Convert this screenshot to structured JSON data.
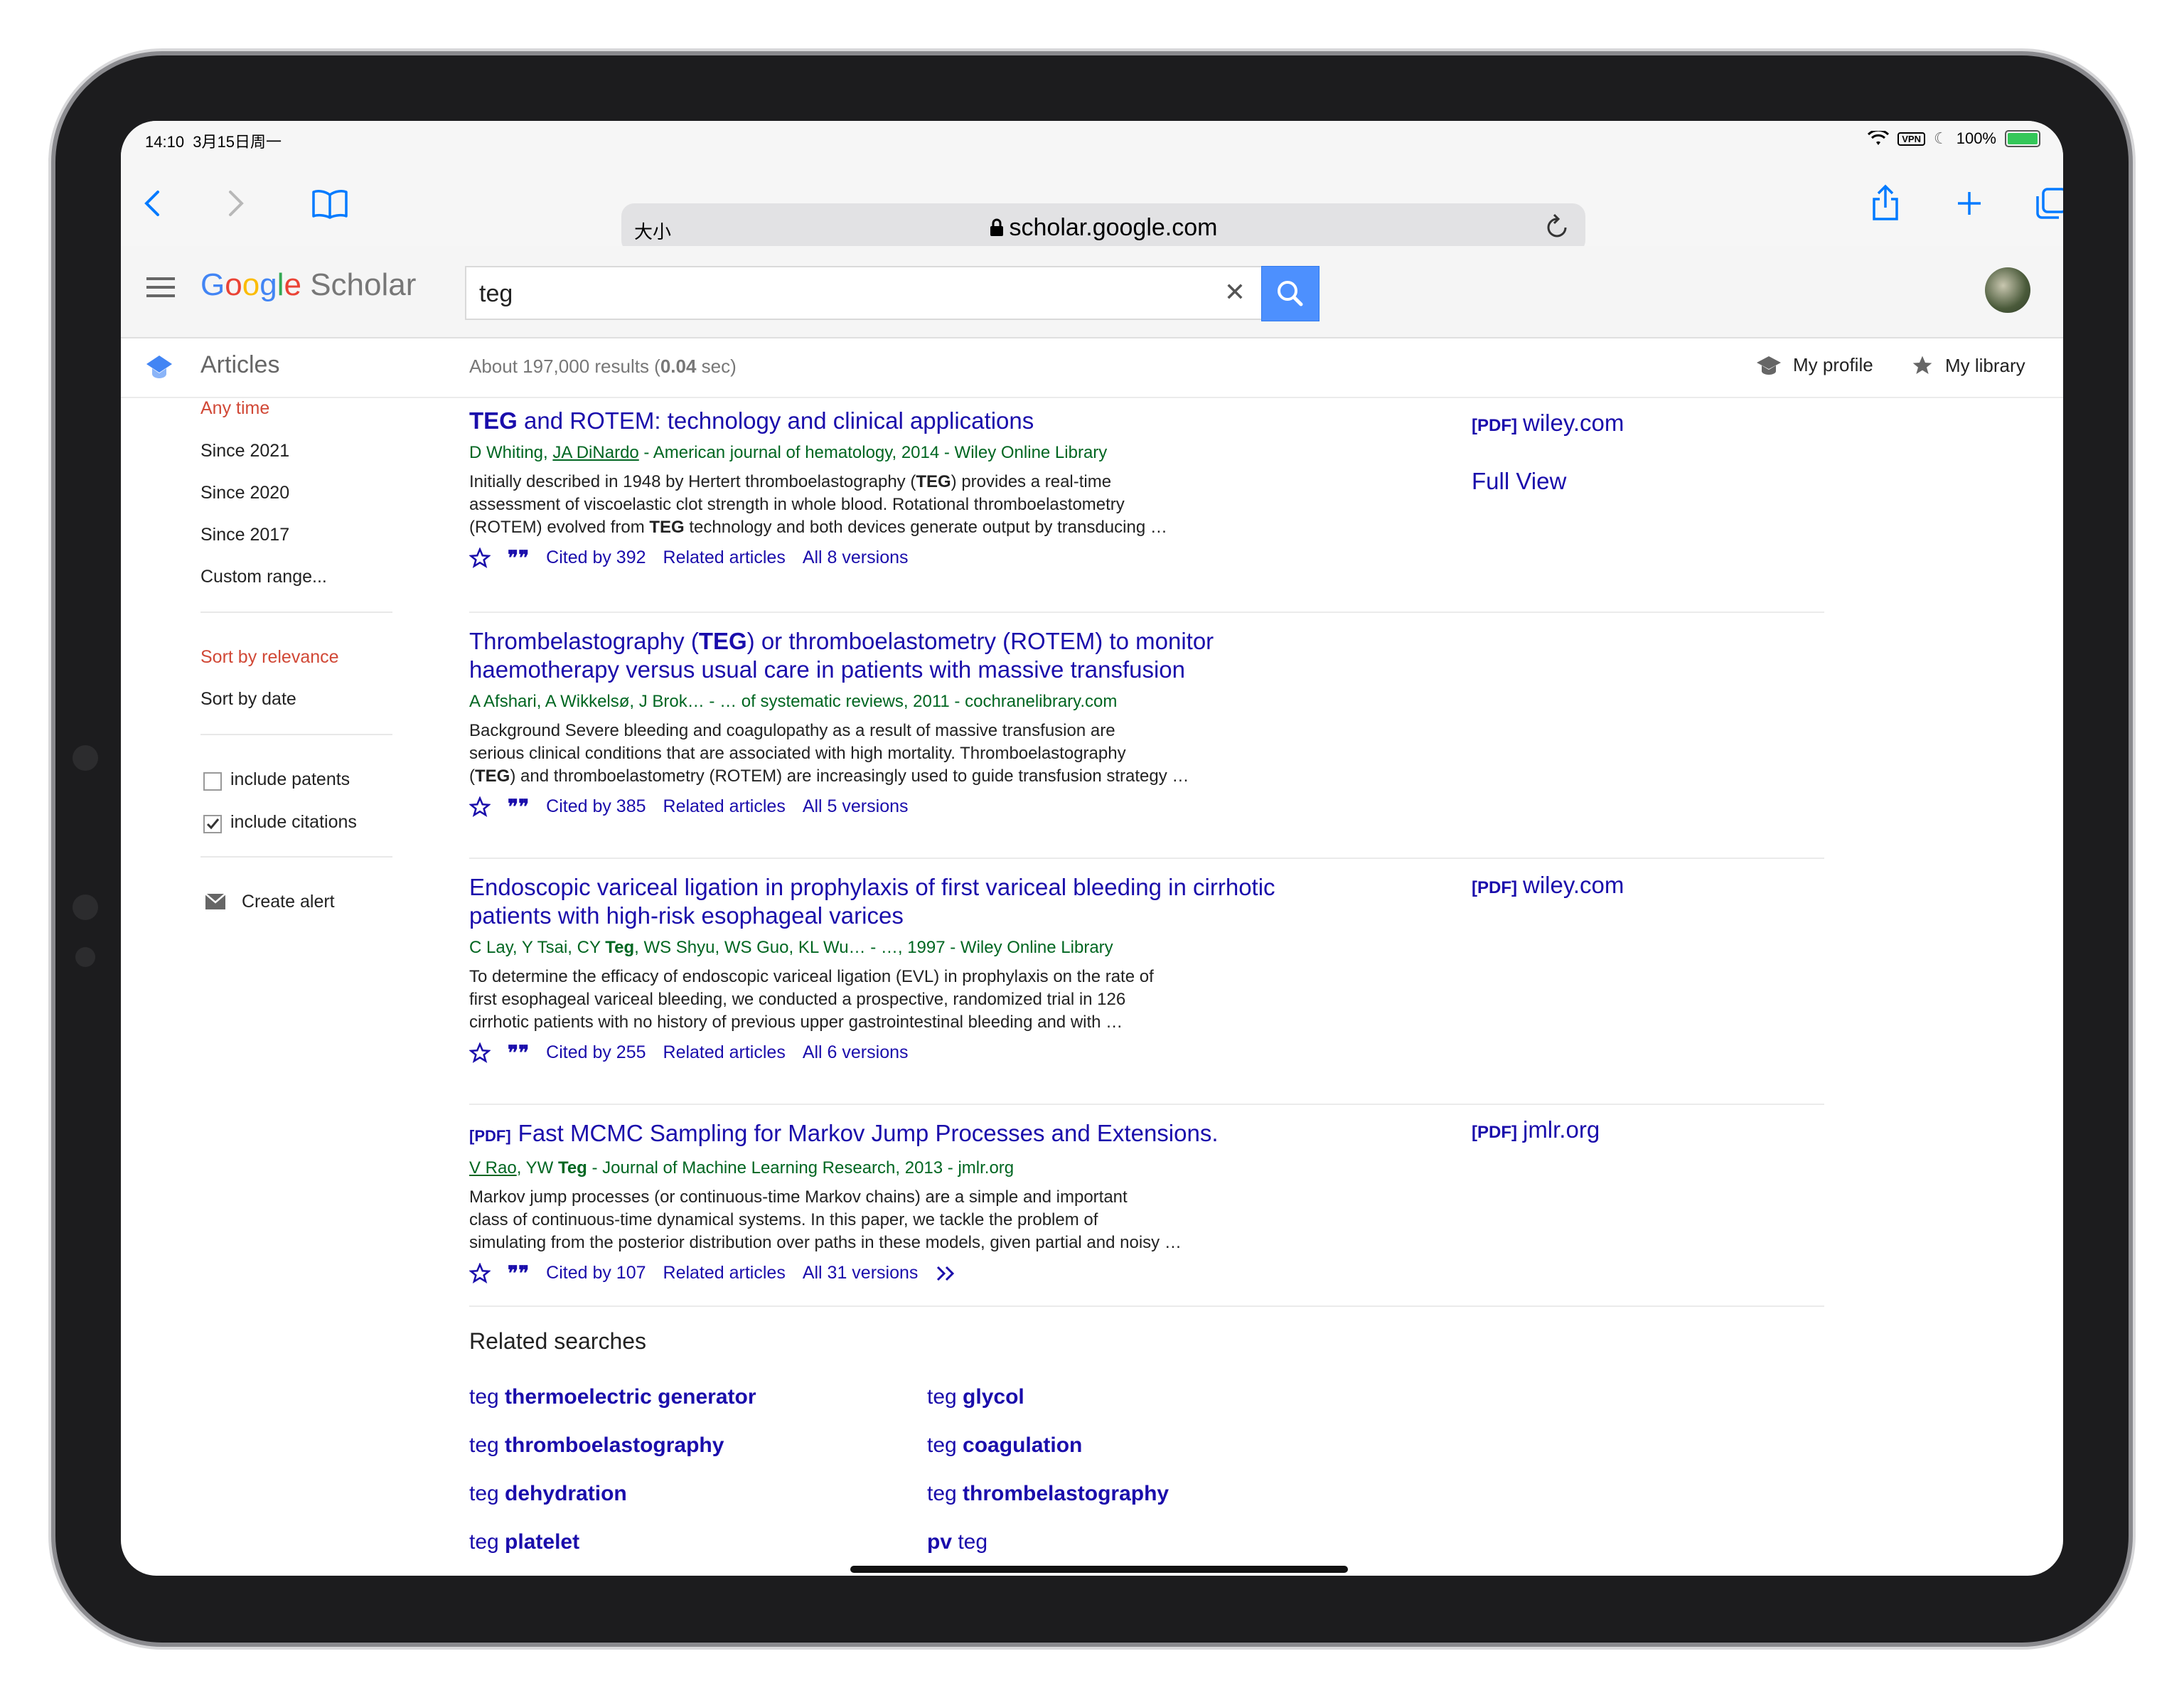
{
  "status": {
    "time": "14:10",
    "date": "3月15日周一",
    "vpn": "VPN",
    "battery": "100%"
  },
  "browser": {
    "text_size_label": "大小",
    "url": "scholar.google.com"
  },
  "scholar": {
    "logo_google": [
      "G",
      "o",
      "o",
      "g",
      "l",
      "e"
    ],
    "logo_scholar": "Scholar",
    "query": "teg",
    "section_title": "Articles",
    "results_count_prefix": "About 197,000 results (",
    "results_time": "0.04",
    "results_count_suffix": " sec)",
    "my_profile": "My profile",
    "my_library": "My library"
  },
  "sidebar": {
    "time_filters": [
      "Any time",
      "Since 2021",
      "Since 2020",
      "Since 2017",
      "Custom range..."
    ],
    "sort": [
      "Sort by relevance",
      "Sort by date"
    ],
    "include_patents": "include patents",
    "include_citations": "include citations",
    "create_alert": "Create alert"
  },
  "results": [
    {
      "title_bold": "TEG",
      "title_rest": " and ROTEM: technology and clinical applications",
      "authors_pre": "D Whiting, ",
      "authors_link": "JA DiNardo",
      "authors_post": " - American journal of hematology, 2014 - Wiley Online Library",
      "snippet": [
        "Initially described in 1948 by Hertert thromboelastography (",
        "TEG",
        ") provides a real-time",
        "assessment of viscoelastic clot strength in whole blood. Rotational thromboelastometry",
        "(ROTEM) evolved from ",
        "TEG",
        " technology and both devices generate output by transducing …"
      ],
      "cited": "Cited by 392",
      "related": "Related articles",
      "versions": "All 8 versions",
      "side_pdf_tag": "[PDF]",
      "side_pdf_source": "wiley.com",
      "side_full_view": "Full View"
    },
    {
      "title_line1_pre": "Thrombelastography (",
      "title_line1_bold": "TEG",
      "title_line1_post": ") or thromboelastometry (ROTEM) to monitor",
      "title_line2": "haemotherapy versus usual care in patients with massive transfusion",
      "authors": "A Afshari, A Wikkelsø, J Brok… - … of systematic reviews, 2011 - cochranelibrary.com",
      "snippet_l1": "Background Severe bleeding and coagulopathy as a result of massive transfusion are",
      "snippet_l2": "serious clinical conditions that are associated with high mortality. Thromboelastography",
      "snippet_l3_pre": "(",
      "snippet_l3_bold": "TEG",
      "snippet_l3_post": ") and thromboelastometry (ROTEM) are increasingly used to guide transfusion strategy …",
      "cited": "Cited by 385",
      "related": "Related articles",
      "versions": "All 5 versions"
    },
    {
      "title_line1": "Endoscopic variceal ligation in prophylaxis of first variceal bleeding in cirrhotic",
      "title_line2": "patients with high-risk esophageal varices",
      "authors_pre": "C Lay, Y Tsai, CY ",
      "authors_bold": "Teg",
      "authors_post": ", WS Shyu, WS Guo, KL Wu… - …, 1997 - Wiley Online Library",
      "snippet_l1": "To determine the efficacy of endoscopic variceal ligation (EVL) in prophylaxis on the rate of",
      "snippet_l2": "first esophageal variceal bleeding, we conducted a prospective, randomized trial in 126",
      "snippet_l3": "cirrhotic patients with no history of previous upper gastrointestinal bleeding and with …",
      "cited": "Cited by 255",
      "related": "Related articles",
      "versions": "All 6 versions",
      "side_pdf_tag": "[PDF]",
      "side_pdf_source": "wiley.com"
    },
    {
      "title_tag": "[PDF]",
      "title": "Fast MCMC Sampling for Markov Jump Processes and Extensions.",
      "authors_link": "V Rao",
      "authors_mid": ", YW ",
      "authors_bold": "Teg",
      "authors_post": " - Journal of Machine Learning Research, 2013 - jmlr.org",
      "snippet_l1": "Markov jump processes (or continuous-time Markov chains) are a simple and important",
      "snippet_l2": "class of continuous-time dynamical systems. In this paper, we tackle the problem of",
      "snippet_l3": "simulating from the posterior distribution over paths in these models, given partial and noisy …",
      "cited": "Cited by 107",
      "related": "Related articles",
      "versions": "All 31 versions",
      "side_pdf_tag": "[PDF]",
      "side_pdf_source": "jmlr.org"
    }
  ],
  "related_searches": {
    "heading": "Related searches",
    "items": [
      {
        "pre": "teg ",
        "bold": "thermoelectric generator"
      },
      {
        "pre": "teg ",
        "bold": "glycol"
      },
      {
        "pre": "teg ",
        "bold": "thromboelastography"
      },
      {
        "pre": "teg ",
        "bold": "coagulation"
      },
      {
        "pre": "teg ",
        "bold": "dehydration"
      },
      {
        "pre": "teg ",
        "bold": "thrombelastography"
      },
      {
        "pre": "teg ",
        "bold": "platelet"
      },
      {
        "bold": "pv",
        "post": " teg"
      }
    ]
  },
  "colors": {
    "link": "#1a0dab",
    "authors": "#006621",
    "active_filter": "#d14836",
    "search_button": "#4d90fe",
    "safari_accent": "#007aff"
  }
}
